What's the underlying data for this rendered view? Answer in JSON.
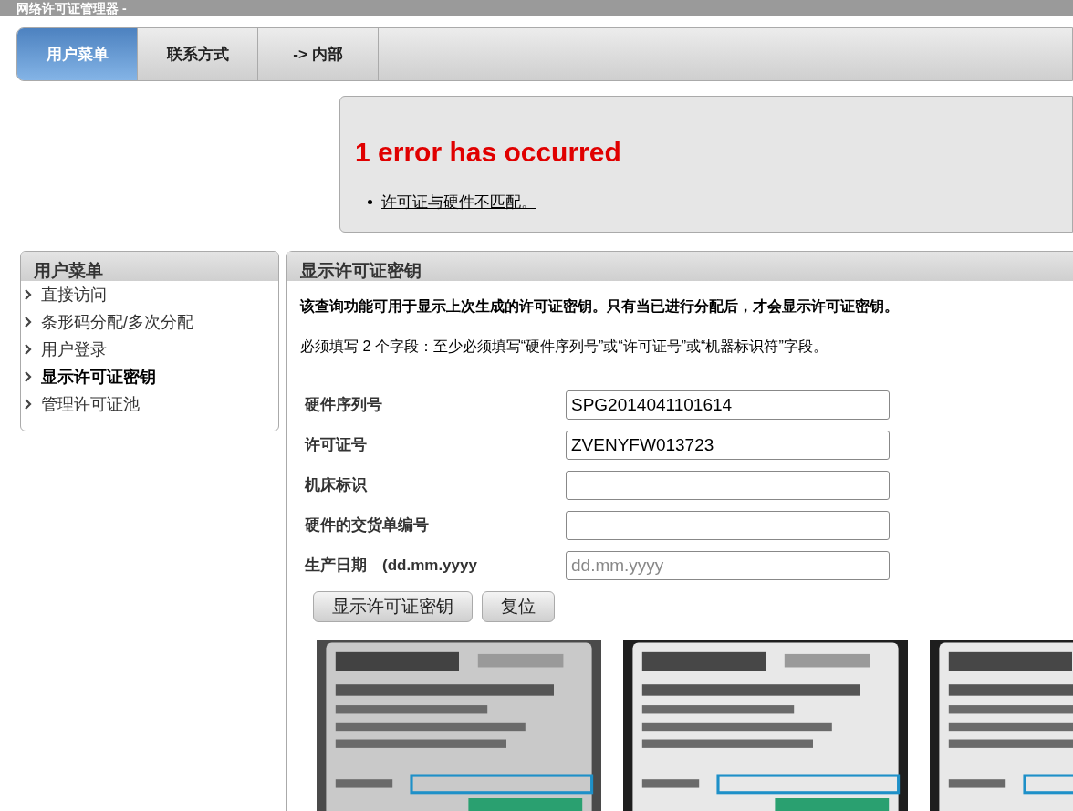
{
  "window": {
    "title": "网络许可证管理器 -"
  },
  "tabs": [
    {
      "label": "用户菜单",
      "selected": true
    },
    {
      "label": "联系方式",
      "selected": false
    },
    {
      "label": "-> 内部",
      "selected": false
    }
  ],
  "error": {
    "title": "1 error has occurred",
    "messages": [
      "许可证与硬件不匹配。"
    ]
  },
  "sidebar": {
    "title": "用户菜单",
    "items": [
      {
        "label": "直接访问",
        "selected": false
      },
      {
        "label": "条形码分配/多次分配",
        "selected": false
      },
      {
        "label": "用户登录",
        "selected": false
      },
      {
        "label": "显示许可证密钥",
        "selected": true
      },
      {
        "label": "管理许可证池",
        "selected": false
      }
    ]
  },
  "panel": {
    "title": "显示许可证密钥",
    "intro": "该查询功能可用于显示上次生成的许可证密钥。只有当已进行分配后，才会显示许可证密钥。",
    "note": "必须填写 2 个字段：至少必须填写“硬件序列号”或“许可证号”或“机器标识符”字段。",
    "fields": [
      {
        "label": "硬件序列号",
        "value": "SPG2014041101614"
      },
      {
        "label": "许可证号",
        "value": "ZVENYFW013723"
      },
      {
        "label": "机床标识"
      },
      {
        "label": "硬件的交货单编号"
      },
      {
        "label": "生产日期　(dd.mm.yyyy",
        "placeholder": "dd.mm.yyyy"
      }
    ],
    "buttons": [
      "显示许可证密钥",
      "复位"
    ],
    "photos": [
      {
        "kind": "picture"
      },
      {
        "kind": "picture"
      },
      {
        "kind": "picture"
      }
    ]
  }
}
